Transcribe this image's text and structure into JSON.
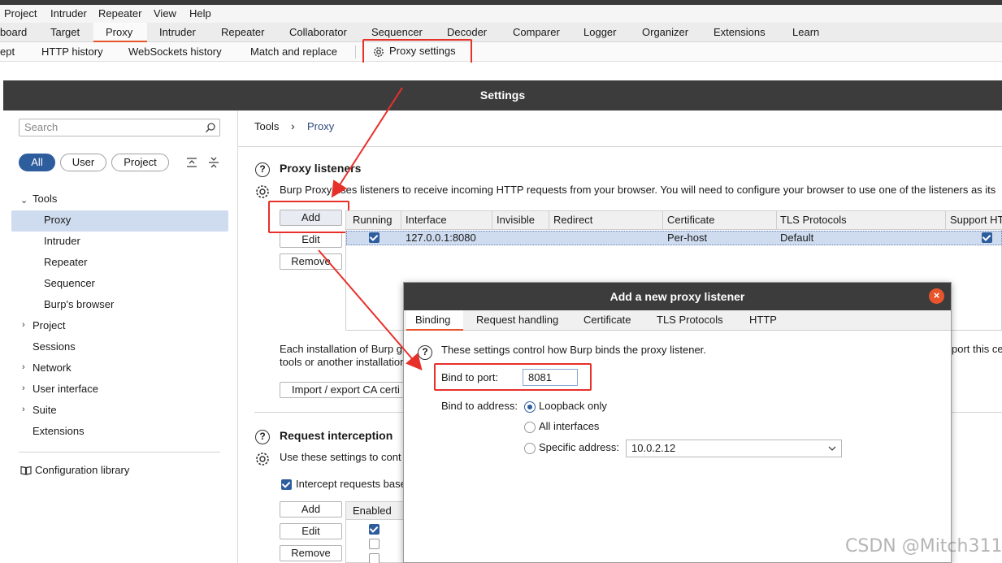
{
  "menu": [
    "Project",
    "Intruder",
    "Repeater",
    "View",
    "Help"
  ],
  "main_tabs": [
    "board",
    "Target",
    "Proxy",
    "Intruder",
    "Repeater",
    "Collaborator",
    "Sequencer",
    "Decoder",
    "Comparer",
    "Logger",
    "Organizer",
    "Extensions",
    "Learn"
  ],
  "sub_tabs": [
    "ept",
    "HTTP history",
    "WebSockets history",
    "Match and replace",
    "Proxy settings"
  ],
  "settings": {
    "title": "Settings",
    "search_placeholder": "Search",
    "filters": [
      "All",
      "User",
      "Project"
    ],
    "nav": {
      "tools": "Tools",
      "tools_children": [
        "Proxy",
        "Intruder",
        "Repeater",
        "Sequencer",
        "Burp's browser"
      ],
      "project": "Project",
      "sessions": "Sessions",
      "network": "Network",
      "user_interface": "User interface",
      "suite": "Suite",
      "extensions": "Extensions",
      "config_library": "Configuration library"
    },
    "breadcrumb": [
      "Tools",
      "Proxy"
    ],
    "listeners": {
      "heading": "Proxy listeners",
      "description": "Burp Proxy uses listeners to receive incoming HTTP requests from your browser. You will need to configure your browser to use one of the listeners as its",
      "buttons": [
        "Add",
        "Edit",
        "Remove"
      ],
      "columns": [
        "Running",
        "Interface",
        "Invisible",
        "Redirect",
        "Certificate",
        "TLS Protocols",
        "Support HT"
      ],
      "row": {
        "interface": "127.0.0.1:8080",
        "certificate": "Per-host",
        "tls": "Default"
      }
    },
    "ca_text_1": "Each installation of Burp g",
    "ca_text_1_right": "port this ce",
    "ca_text_2": "tools or another installation",
    "import_button": "Import / export CA certi",
    "interception": {
      "heading": "Request interception",
      "description": "Use these settings to cont",
      "checkbox_label": "Intercept requests base",
      "buttons": [
        "Add",
        "Edit",
        "Remove"
      ],
      "column": "Enabled"
    }
  },
  "dialog": {
    "title": "Add a new proxy listener",
    "close_glyph": "×",
    "tabs": [
      "Binding",
      "Request handling",
      "Certificate",
      "TLS Protocols",
      "HTTP"
    ],
    "description": "These settings control how Burp binds the proxy listener.",
    "port_label": "Bind to port:",
    "port_value": "8081",
    "address_label": "Bind to address:",
    "options": [
      "Loopback only",
      "All interfaces",
      "Specific address:"
    ],
    "specific_address": "10.0.2.12"
  },
  "watermark": "CSDN @Mitch311",
  "colors": {
    "accent": "#e8542b",
    "selection": "#cfdcef",
    "primary": "#2e5d9e",
    "annotation": "#e8302a"
  }
}
